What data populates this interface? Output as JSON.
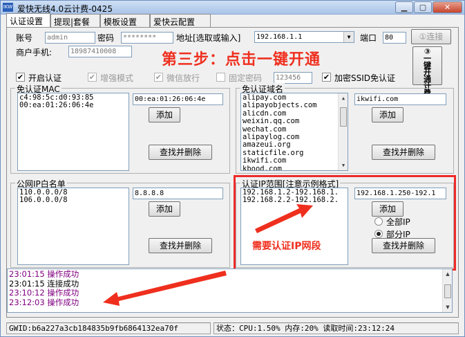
{
  "window": {
    "title": "爱快无线4.0云计费-0425",
    "app_icon_text": "IKW",
    "minimize": "▁",
    "maximize": "▢",
    "close": "✕"
  },
  "tabs": [
    {
      "label": "认证设置"
    },
    {
      "label": "提现|套餐"
    },
    {
      "label": "模板设置"
    },
    {
      "label": "爱快云配置"
    }
  ],
  "config": {
    "account_label": "账号",
    "account_value": "admin",
    "password_label": "密码",
    "password_value": "********",
    "address_label": "地址[选取或输入]",
    "address_value": "192.168.1.1",
    "port_label": "端口",
    "port_value": "80",
    "connect_button": "①连接",
    "merchant_phone_label": "商户手机:",
    "merchant_phone_value": "18987410008",
    "one_click_button": [
      "③",
      "一",
      "键",
      "开",
      "通",
      "计",
      "费"
    ]
  },
  "options": [
    {
      "label": "开启认证",
      "checked": true,
      "enabled": true
    },
    {
      "label": "增强模式",
      "checked": true,
      "enabled": false
    },
    {
      "label": "微信放行",
      "checked": true,
      "enabled": false
    },
    {
      "label": "固定密码",
      "checked": false,
      "enabled": false
    },
    {
      "label": "加密SSID免认证",
      "checked": true,
      "enabled": true
    }
  ],
  "fixed_password_value": "123456",
  "annotation": {
    "step_text": "第三步：点击一键开通",
    "ip_note": "需要认证IP网段"
  },
  "mac_whitelist": {
    "title": "免认证MAC",
    "items": [
      "c4:98:5c:d0:93:85",
      "00:ea:01:26:06:4e"
    ],
    "input_value": "00:ea:01:26:06:4e",
    "add_button": "添加",
    "find_delete_button": "查找并删除"
  },
  "domain_whitelist": {
    "title": "免认证域名",
    "items": [
      "alipay.com",
      "alipayobjects.com",
      "alicdn.com",
      "weixin.qq.com",
      "wechat.com",
      "alipaylog.com",
      "amazeui.org",
      "staticfile.org",
      "ikwifi.com",
      "kbood.com"
    ],
    "input_value": "ikwifi.com",
    "add_button": "添加",
    "find_delete_button": "查找并删除"
  },
  "public_ip_whitelist": {
    "title": "公网IP白名单",
    "items": [
      "110.0.0.0/8",
      "106.0.0.0/8"
    ],
    "input_value": "8.8.8.8",
    "add_button": "添加",
    "find_delete_button": "查找并删除"
  },
  "auth_ip_range": {
    "title": "认证IP范围[注意示例格式]",
    "items": [
      "192.168.1.2-192.168.1.",
      "192.168.2.2-192.168.2."
    ],
    "input_value": "192.168.1.250-192.1",
    "add_button": "添加",
    "radio_all": "全部IP",
    "radio_partial": "部分IP",
    "selected": "部分IP",
    "find_delete_button": "查找并删除"
  },
  "log": [
    {
      "text": "23:01:15 操作成功",
      "color": "#800080"
    },
    {
      "text": "23:01:15 连接成功",
      "color": "#000000"
    },
    {
      "text": "23:10:12 操作成功",
      "color": "#800080"
    },
    {
      "text": "23:12:03 操作成功",
      "color": "#800080"
    }
  ],
  "status_bar": {
    "gwid": "GWID:b6a227a3cb184835b9fb6864132ea70f",
    "status": "状态：CPU:1.50% 内存:20% 读取时间:23:12:24"
  },
  "colors": {
    "annotation_red": "#ef2f1e",
    "log_purple": "#800080"
  }
}
